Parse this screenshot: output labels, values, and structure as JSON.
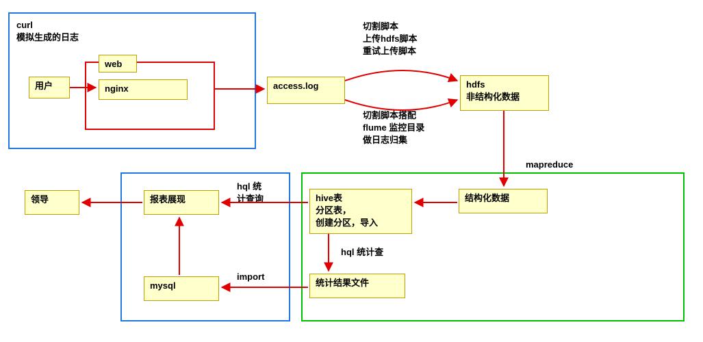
{
  "curl": {
    "title": "curl",
    "sub": "模拟生成的日志"
  },
  "user_box": "用户",
  "web_box": "web",
  "nginx_box": "nginx",
  "access_log_box": "access.log",
  "hdfs_box_1": "hdfs",
  "hdfs_box_2": "非结构化数据",
  "scripts_top_1": "切割脚本",
  "scripts_top_2": "上传hdfs脚本",
  "scripts_top_3": "重试上传脚本",
  "scripts_bottom_1": "切割脚本搭配",
  "scripts_bottom_2": "flume 监控目录",
  "scripts_bottom_3": "做日志归集",
  "mapreduce_label": "mapreduce",
  "struct_box": "结构化数据",
  "hive_box_1": "hive表",
  "hive_box_2": "分区表，",
  "hive_box_3": "创建分区，导入",
  "hql_stat": "hql 统计查",
  "stat_file_box": "统计结果文件",
  "hql_query_1": "hql 统",
  "hql_query_2": "计查询",
  "report_box": "报表展现",
  "import_label": "import",
  "mysql_box": "mysql",
  "leader_box": "领导"
}
